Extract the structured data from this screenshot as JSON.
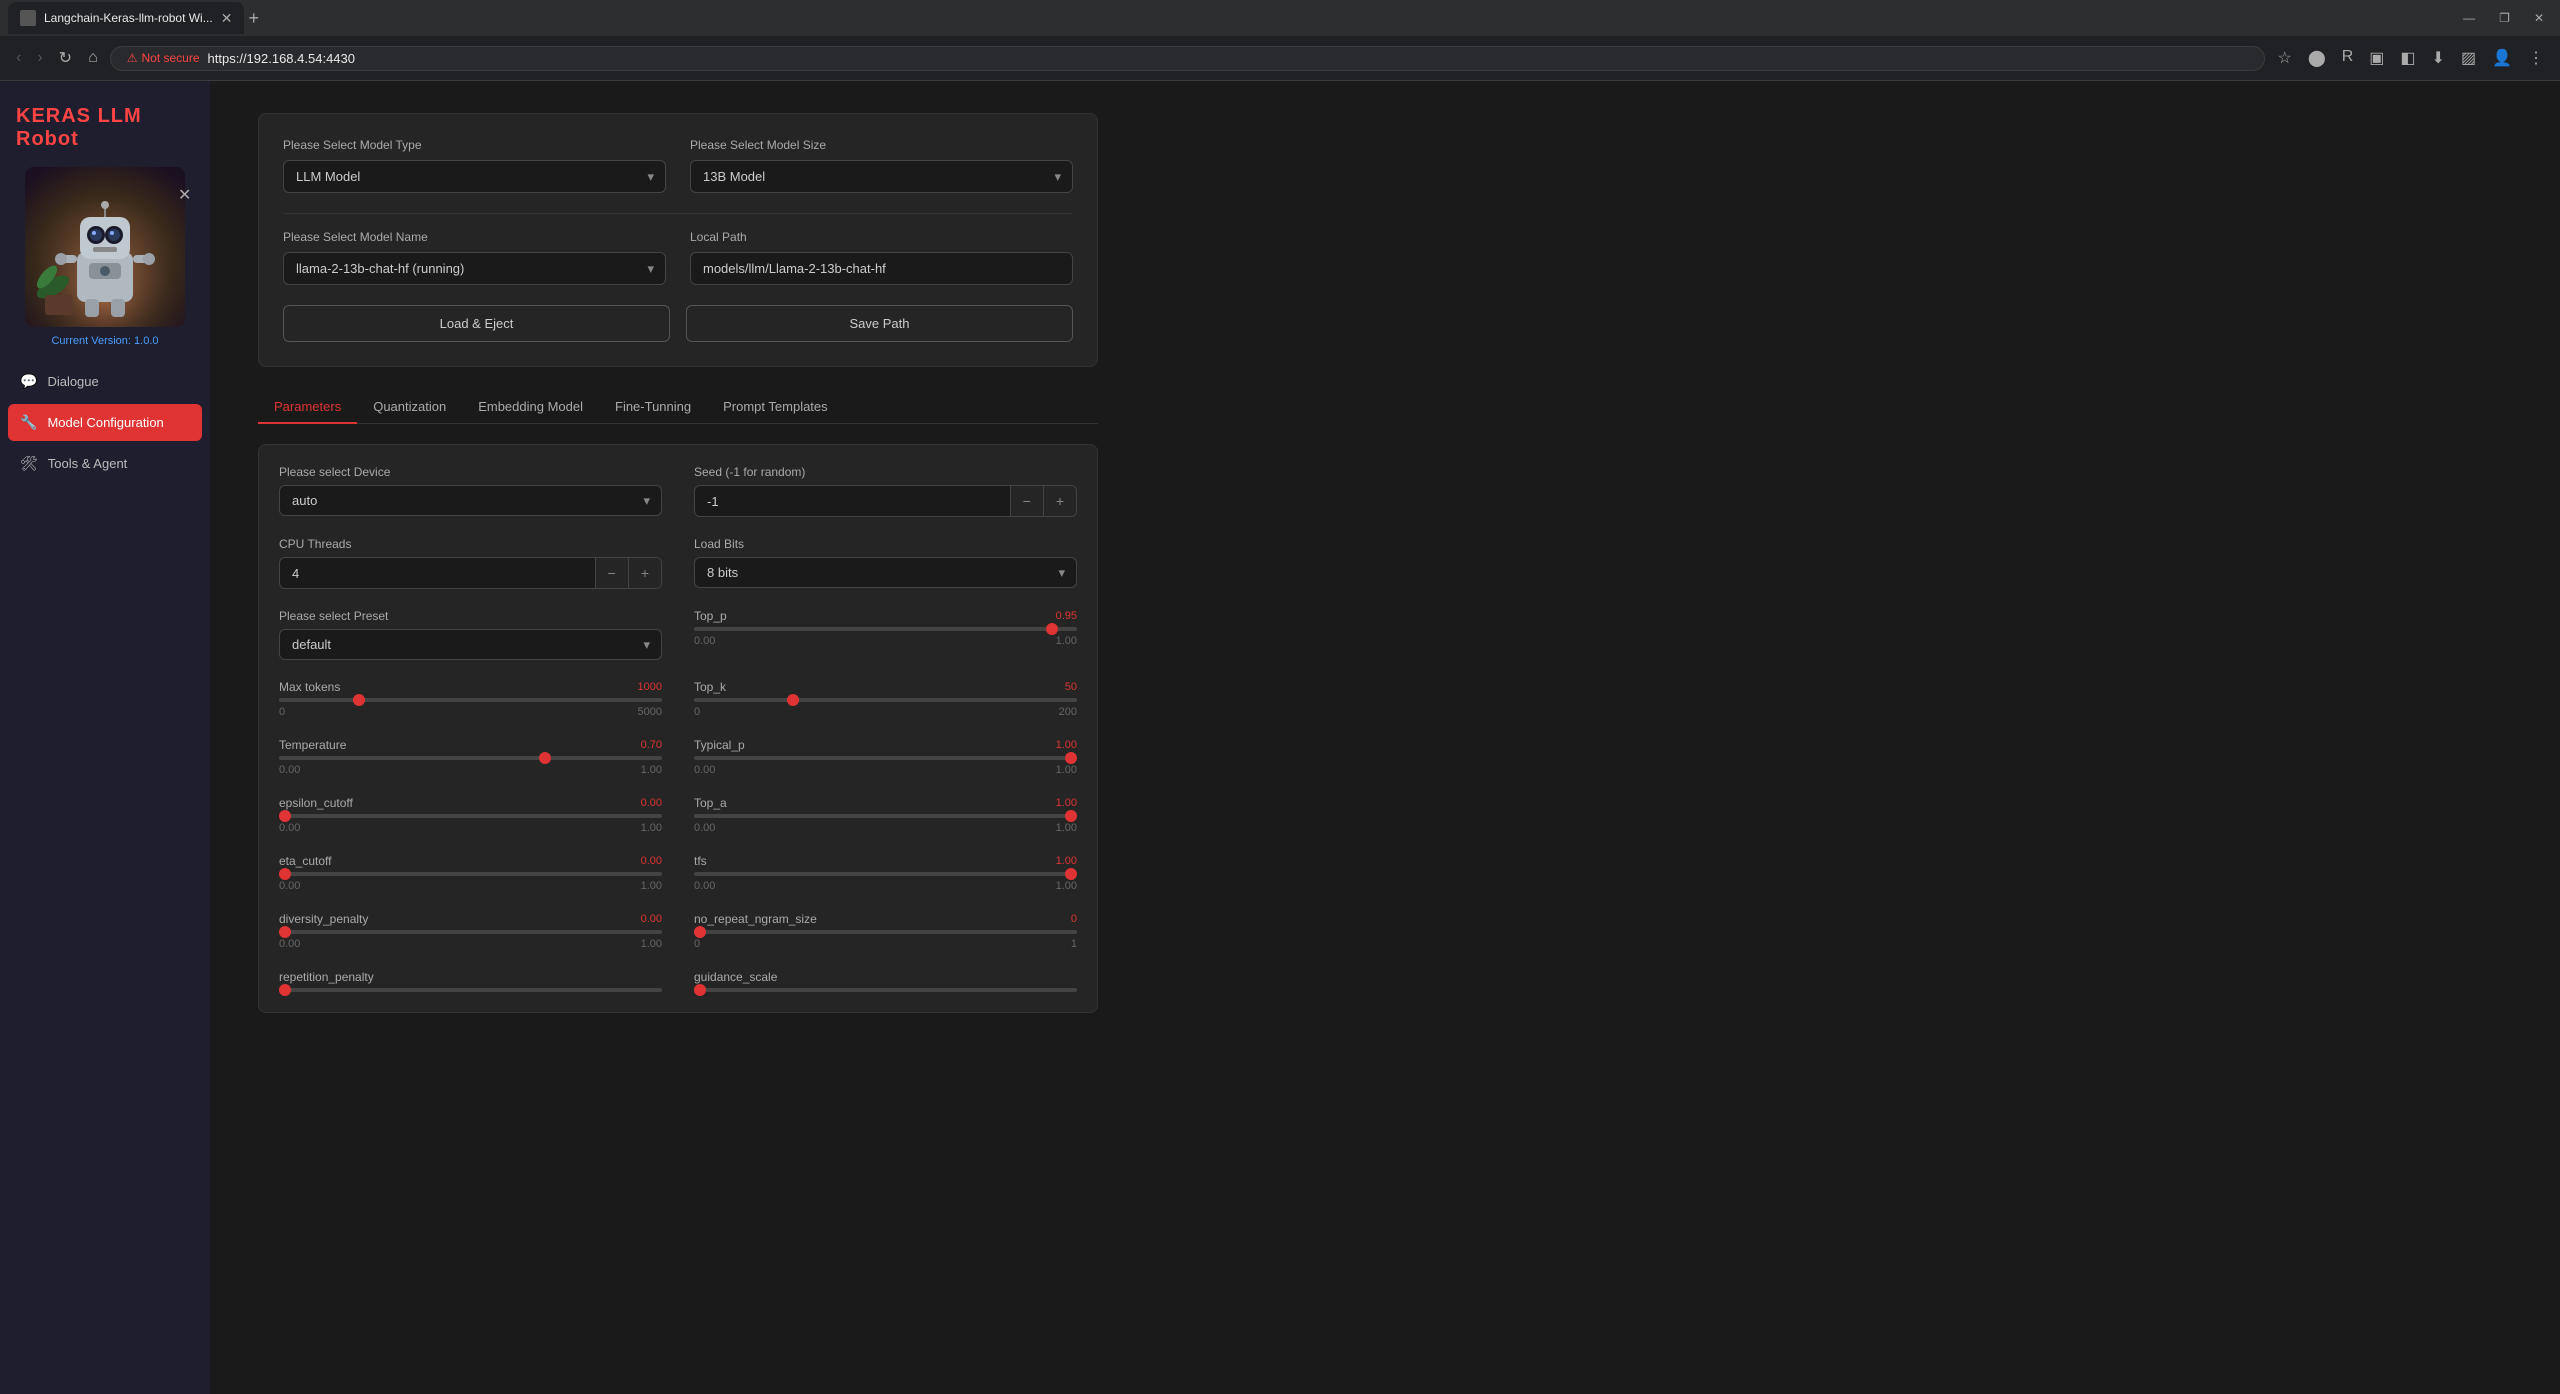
{
  "browser": {
    "tab_title": "Langchain-Keras-llm-robot Wi...",
    "url": "https://192.168.4.54:4430",
    "not_secure_label": "Not secure"
  },
  "sidebar": {
    "title": "KERAS LLM Robot",
    "version": "Current Version: 1.0.0",
    "nav_items": [
      {
        "id": "dialogue",
        "label": "Dialogue",
        "icon": "💬",
        "active": false
      },
      {
        "id": "model-config",
        "label": "Model Configuration",
        "icon": "🔧",
        "active": true
      },
      {
        "id": "tools-agent",
        "label": "Tools & Agent",
        "icon": "🛠",
        "active": false
      }
    ]
  },
  "model_selection": {
    "model_type_label": "Please Select Model Type",
    "model_type_value": "LLM Model",
    "model_size_label": "Please Select Model Size",
    "model_size_value": "13B Model",
    "model_name_label": "Please Select Model Name",
    "model_name_value": "llama-2-13b-chat-hf (running)",
    "local_path_label": "Local Path",
    "local_path_value": "models/llm/Llama-2-13b-chat-hf",
    "load_eject_label": "Load & Eject",
    "save_path_label": "Save Path"
  },
  "tabs": [
    {
      "id": "parameters",
      "label": "Parameters",
      "active": true
    },
    {
      "id": "quantization",
      "label": "Quantization",
      "active": false
    },
    {
      "id": "embedding",
      "label": "Embedding Model",
      "active": false
    },
    {
      "id": "fine-tuning",
      "label": "Fine-Tunning",
      "active": false
    },
    {
      "id": "prompt",
      "label": "Prompt Templates",
      "active": false
    }
  ],
  "parameters": {
    "device_label": "Please select Device",
    "device_value": "auto",
    "seed_label": "Seed (-1 for random)",
    "seed_value": "-1",
    "cpu_threads_label": "CPU Threads",
    "cpu_threads_value": "4",
    "load_bits_label": "Load Bits",
    "load_bits_value": "8 bits",
    "preset_label": "Please select Preset",
    "preset_value": "default",
    "sliders": [
      {
        "id": "top_p",
        "label": "Top_p",
        "value": 0.95,
        "min": 0.0,
        "max": 1.0,
        "display": "0.95"
      },
      {
        "id": "max_tokens",
        "label": "Max tokens",
        "value": 1000,
        "min": 0,
        "max": 5000,
        "display": "1000",
        "fill_pct": 20
      },
      {
        "id": "top_k",
        "label": "Top_k",
        "value": 50,
        "min": 0,
        "max": 200,
        "display": "50",
        "fill_pct": 25
      },
      {
        "id": "temperature",
        "label": "Temperature",
        "value": 0.7,
        "min": 0.0,
        "max": 1.0,
        "display": "0.70",
        "fill_pct": 70
      },
      {
        "id": "typical_p",
        "label": "Typical_p",
        "value": 1.0,
        "min": 0.0,
        "max": 1.0,
        "display": "1.00",
        "fill_pct": 100
      },
      {
        "id": "epsilon_cutoff",
        "label": "epsilon_cutoff",
        "value": 0.0,
        "min": 0.0,
        "max": 1.0,
        "display": "0.00",
        "fill_pct": 0
      },
      {
        "id": "top_a",
        "label": "Top_a",
        "value": 1.0,
        "min": 0.0,
        "max": 1.0,
        "display": "1.00",
        "fill_pct": 100
      },
      {
        "id": "eta_cutoff",
        "label": "eta_cutoff",
        "value": 0.0,
        "min": 0.0,
        "max": 1.0,
        "display": "0.00",
        "fill_pct": 0
      },
      {
        "id": "tfs",
        "label": "tfs",
        "value": 1.0,
        "min": 0.0,
        "max": 1.0,
        "display": "1.00",
        "fill_pct": 100
      },
      {
        "id": "diversity_penalty",
        "label": "diversity_penalty",
        "value": 0.0,
        "min": 0.0,
        "max": 1.0,
        "display": "0.00",
        "fill_pct": 0
      },
      {
        "id": "no_repeat_ngram",
        "label": "no_repeat_ngram_size",
        "value": 0,
        "min": 0,
        "max": 1,
        "display": "0",
        "fill_pct": 0
      },
      {
        "id": "repetition_penalty",
        "label": "repetition_penalty",
        "value": null,
        "min": null,
        "max": null,
        "display": "",
        "fill_pct": 0
      },
      {
        "id": "guidance_scale",
        "label": "guidance_scale",
        "value": null,
        "min": null,
        "max": null,
        "display": "",
        "fill_pct": 0
      }
    ]
  }
}
